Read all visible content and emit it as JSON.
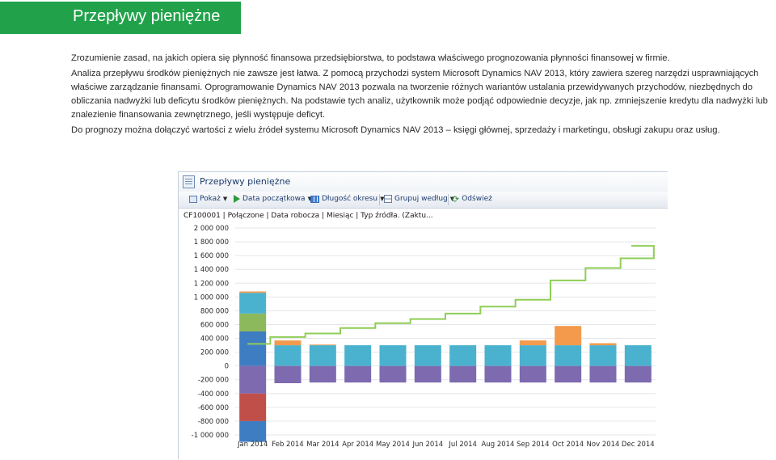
{
  "header": {
    "title": "Przepływy pieniężne"
  },
  "body_paragraphs": [
    "Zrozumienie zasad, na jakich opiera się płynność finansowa przedsiębiorstwa, to podstawa właściwego prognozowania płynności finansowej w firmie.",
    "Analiza przepływu środków pieniężnych nie zawsze jest łatwa. Z pomocą przychodzi system Microsoft Dynamics NAV 2013, który zawiera szereg narzędzi usprawniających właściwe zarządzanie finansami. Oprogramowanie Dynamics NAV 2013 pozwala na tworzenie różnych wariantów ustalania przewidywanych przychodów, niezbędnych do obliczania nadwyżki lub deficytu środków pieniężnych. Na podstawie tych analiz, użytkownik może podjąć odpowiednie decyzje, jak np. zmniejszenie kredytu dla nadwyżki lub znalezienie finansowania zewnętrznego, jeśli występuje deficyt.",
    "Do prognozy można dołączyć wartości z wielu źródeł systemu Microsoft Dynamics NAV 2013 – księgi głównej, sprzedaży i marketingu, obsługi zakupu oraz usług."
  ],
  "app": {
    "title": "Przepływy pieniężne",
    "toolbar": {
      "show": "Pokaż",
      "start_date": "Data początkowa",
      "period_length": "Długość okresu",
      "group_by": "Grupuj według",
      "refresh": "Odśwież"
    },
    "info_line": "CF100001 | Połączone | Data robocza | Miesiąc | Typ źródła.  (Zaktu..."
  },
  "colors": {
    "brand_green": "#21a24a",
    "teal": "#4ab2cf",
    "purple": "#7d6aaf",
    "blue": "#3f7dc3",
    "red": "#c04f4a",
    "lime": "#8bb95b",
    "orange": "#f39a4d",
    "line": "#8fce56"
  },
  "chart_data": {
    "type": "bar",
    "stacked": true,
    "title": "",
    "xlabel": "",
    "ylabel": "",
    "ylim": [
      -1000000,
      2000000
    ],
    "yticks": [
      2000000,
      1800000,
      1600000,
      1400000,
      1200000,
      1000000,
      800000,
      600000,
      400000,
      200000,
      0,
      -200000,
      -400000,
      -600000,
      -800000,
      -1000000
    ],
    "ytick_labels": [
      "2 000 000",
      "1 800 000",
      "1 600 000",
      "1 400 000",
      "1 200 000",
      "1 000 000",
      "800 000",
      "600 000",
      "400 000",
      "200 000",
      "0",
      "-200 000",
      "-400 000",
      "-600 000",
      "-800 000",
      "-1 000 000"
    ],
    "categories": [
      "Jan 2014",
      "Feb 2014",
      "Mar 2014",
      "Apr 2014",
      "May 2014",
      "Jun 2014",
      "Jul 2014",
      "Aug 2014",
      "Sep 2014",
      "Oct 2014",
      "Nov 2014",
      "Dec 2014"
    ],
    "grid": true,
    "legend": "none",
    "series": [
      {
        "color": "#3f7dc3",
        "values": [
          500000,
          0,
          0,
          0,
          0,
          0,
          0,
          0,
          0,
          0,
          0,
          0
        ]
      },
      {
        "color": "#8bb95b",
        "values": [
          260000,
          0,
          0,
          0,
          0,
          0,
          0,
          0,
          0,
          0,
          0,
          0
        ]
      },
      {
        "color": "#4ab2cf",
        "values": [
          300000,
          300000,
          300000,
          300000,
          300000,
          300000,
          300000,
          300000,
          300000,
          300000,
          300000,
          300000
        ]
      },
      {
        "color": "#f39a4d",
        "values": [
          20000,
          70000,
          10000,
          0,
          0,
          0,
          0,
          0,
          70000,
          280000,
          30000,
          0
        ]
      },
      {
        "color": "#7d6aaf",
        "values": [
          -400000,
          -250000,
          -240000,
          -240000,
          -240000,
          -240000,
          -240000,
          -240000,
          -240000,
          -240000,
          -240000,
          -240000
        ]
      },
      {
        "color": "#c04f4a",
        "values": [
          -400000,
          0,
          0,
          0,
          0,
          0,
          0,
          0,
          0,
          0,
          0,
          0
        ]
      },
      {
        "color": "#3f7dc3",
        "values": [
          -300000,
          0,
          0,
          0,
          0,
          0,
          0,
          0,
          0,
          0,
          0,
          0
        ]
      }
    ],
    "line_series": {
      "type": "step",
      "color": "#8fce56",
      "values": [
        320000,
        420000,
        470000,
        550000,
        620000,
        680000,
        760000,
        860000,
        960000,
        1240000,
        1420000,
        1560000,
        1740000
      ]
    }
  }
}
